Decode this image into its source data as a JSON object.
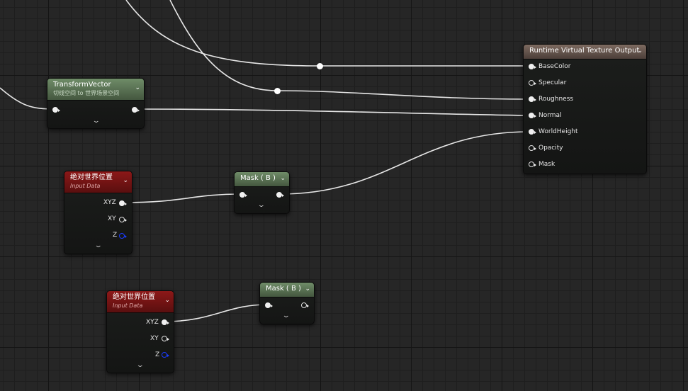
{
  "nodes": {
    "transform_vector": {
      "title": "TransformVector",
      "subtitle": "切线空间 to 世界场景空间",
      "header_color": "#5f7a59"
    },
    "rvt_output": {
      "title": "Runtime Virtual Texture Output",
      "header_color": "#6e5d55",
      "inputs": [
        "BaseColor",
        "Specular",
        "Roughness",
        "Normal",
        "WorldHeight",
        "Opacity",
        "Mask"
      ]
    },
    "world_position_1": {
      "title": "绝对世界位置",
      "subtitle": "Input Data",
      "header_color": "#7a1414",
      "outputs": [
        "XYZ",
        "XY",
        "Z"
      ]
    },
    "mask_b_1": {
      "title": "Mask ( B )",
      "header_color": "#5f7a59"
    },
    "world_position_2": {
      "title": "绝对世界位置",
      "subtitle": "Input Data",
      "header_color": "#7a1414",
      "outputs": [
        "XYZ",
        "XY",
        "Z"
      ]
    },
    "mask_b_2": {
      "title": "Mask ( B )",
      "header_color": "#5f7a59"
    }
  },
  "icons": {
    "collapse": "chevron-down-icon",
    "expand": "chevron-down-icon"
  }
}
